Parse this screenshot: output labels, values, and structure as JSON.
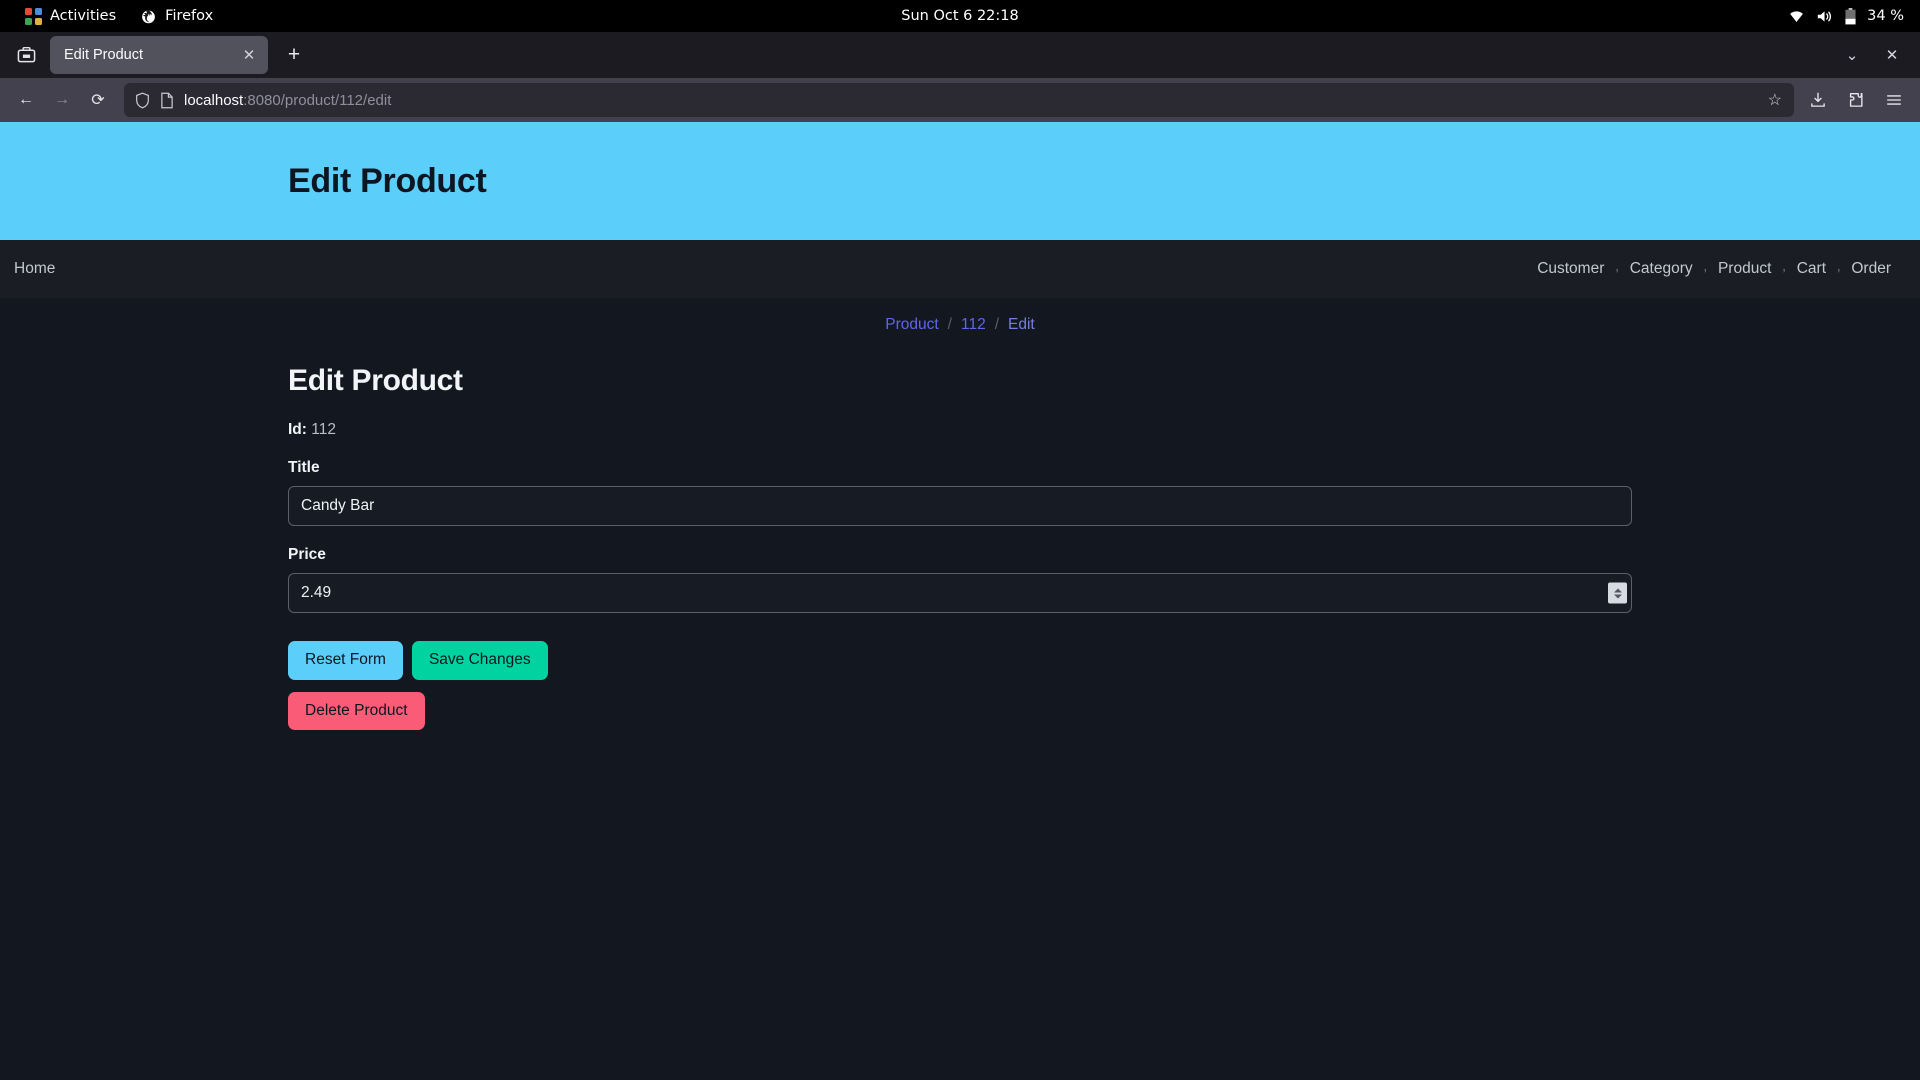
{
  "desktop": {
    "activities_label": "Activities",
    "app_label": "Firefox",
    "clock": "Sun Oct 6  22:18",
    "battery": "34 %",
    "icons": {
      "wifi": "wifi-icon",
      "volume": "volume-icon",
      "battery": "battery-icon"
    }
  },
  "browser": {
    "tab_title": "Edit Product",
    "tab_close": "✕",
    "new_tab": "+",
    "list_all_tabs": "⌄",
    "window_close": "✕",
    "back": "←",
    "forward": "→",
    "reload": "⟳",
    "url_host": "localhost",
    "url_path": ":8080/product/112/edit",
    "bookmark_star": "☆",
    "shield": "shield-icon",
    "page_icon": "page-icon",
    "downloads": "downloads-icon",
    "extensions": "extensions-icon",
    "menu": "hamburger-menu-icon"
  },
  "page": {
    "banner_title": "Edit Product",
    "nav": {
      "home": "Home",
      "separator": "’",
      "items": [
        {
          "label": "Customer"
        },
        {
          "label": "Category"
        },
        {
          "label": "Product"
        },
        {
          "label": "Cart"
        },
        {
          "label": "Order"
        }
      ]
    },
    "breadcrumb": {
      "sep": "/",
      "items": [
        {
          "label": "Product",
          "kind": "link"
        },
        {
          "label": "112",
          "kind": "link"
        },
        {
          "label": "Edit",
          "kind": "current"
        }
      ]
    },
    "heading": "Edit Product",
    "id_label": "Id:",
    "id_value": "112",
    "form": {
      "title_label": "Title",
      "title_value": "Candy Bar",
      "title_placeholder": "",
      "price_label": "Price",
      "price_value": "2.49",
      "price_placeholder": ""
    },
    "buttons": {
      "reset": "Reset Form",
      "save": "Save Changes",
      "delete": "Delete Product"
    },
    "colors": {
      "banner": "#5bcefa",
      "reset": "#5bcefa",
      "save": "#00d2a0",
      "delete": "#fa5c78",
      "background": "#131820",
      "navbar": "#1a1d24",
      "link": "#5f66e8"
    }
  }
}
